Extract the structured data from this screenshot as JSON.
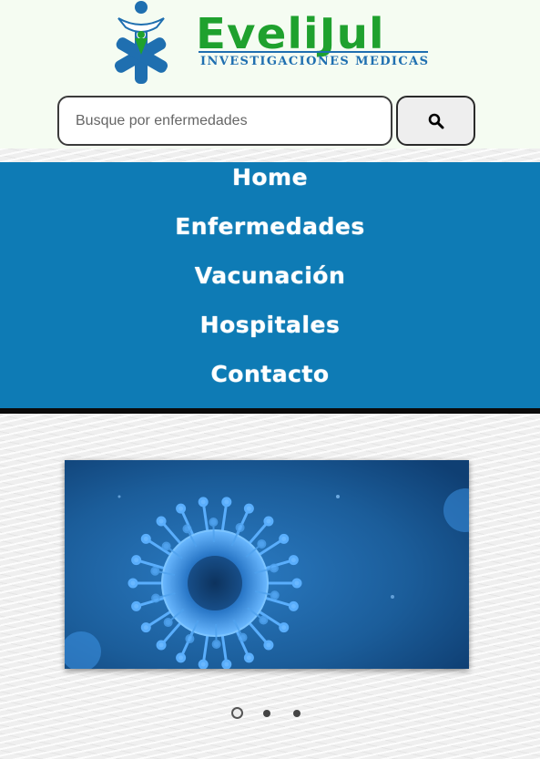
{
  "brand": {
    "name": "EveliJul",
    "tagline": "INVESTIGACIONES MEDICAS",
    "colors": {
      "green": "#1fa12e",
      "blue": "#1f6fb0"
    }
  },
  "search": {
    "placeholder": "Busque por enfermedades",
    "value": "",
    "button_icon": "search-icon"
  },
  "nav": {
    "background": "#0e7bb5",
    "items": [
      {
        "label": "Home"
      },
      {
        "label": "Enfermedades"
      },
      {
        "label": "Vacunación"
      },
      {
        "label": "Hospitales"
      },
      {
        "label": "Contacto"
      }
    ]
  },
  "carousel": {
    "slide_image": "coronavirus-image",
    "slide_count": 3,
    "active_index": 0
  }
}
